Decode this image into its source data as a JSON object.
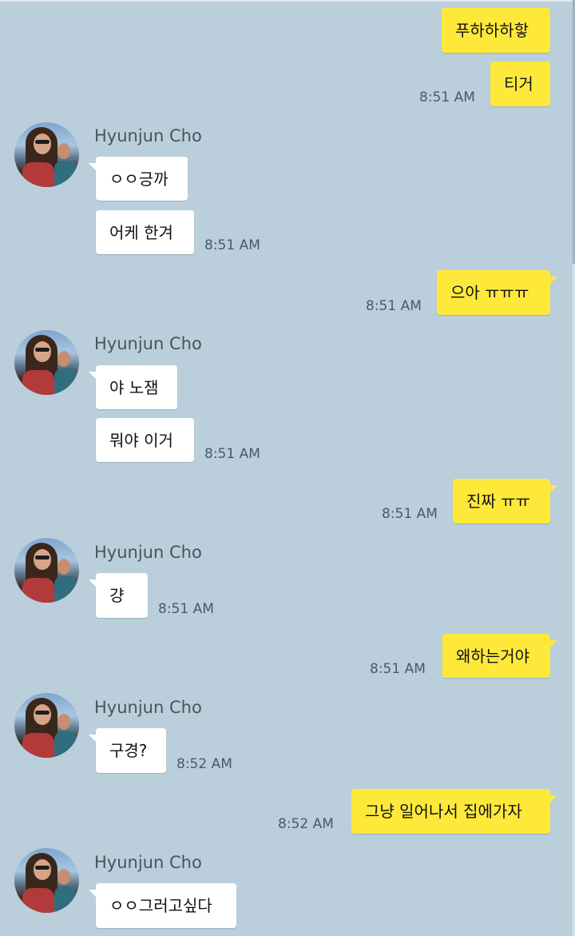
{
  "chat": {
    "contact_name": "Hyunjun Cho",
    "m1": {
      "text": "푸하하하핳"
    },
    "m2": {
      "text": "티거",
      "time": "8:51 AM"
    },
    "g1": {
      "name": "Hyunjun Cho",
      "m1": "ㅇㅇ긍까",
      "m2": "어케 한겨",
      "time": "8:51 AM"
    },
    "m3": {
      "text": "으아 ㅠㅠㅠ",
      "time": "8:51 AM"
    },
    "g2": {
      "name": "Hyunjun Cho",
      "m1": "야 노잼",
      "m2": "뭐야 이거",
      "time": "8:51 AM"
    },
    "m4": {
      "text": "진짜 ㅠㅠ",
      "time": "8:51 AM"
    },
    "g3": {
      "name": "Hyunjun Cho",
      "m1": "걍",
      "time": "8:51 AM"
    },
    "m5": {
      "text": "왜하는거야",
      "time": "8:51 AM"
    },
    "g4": {
      "name": "Hyunjun Cho",
      "m1": "구경?",
      "time": "8:52 AM"
    },
    "m6": {
      "text": "그냥 일어나서 집에가자",
      "time": "8:52 AM"
    },
    "g5": {
      "name": "Hyunjun Cho",
      "m1": "ㅇㅇ그러고싶다"
    }
  },
  "colors": {
    "background": "#bacfdb",
    "my_bubble": "#fee93b",
    "their_bubble": "#ffffff",
    "timestamp": "#4b5a63"
  },
  "icons": {
    "avatar": "contact-profile-photo"
  }
}
